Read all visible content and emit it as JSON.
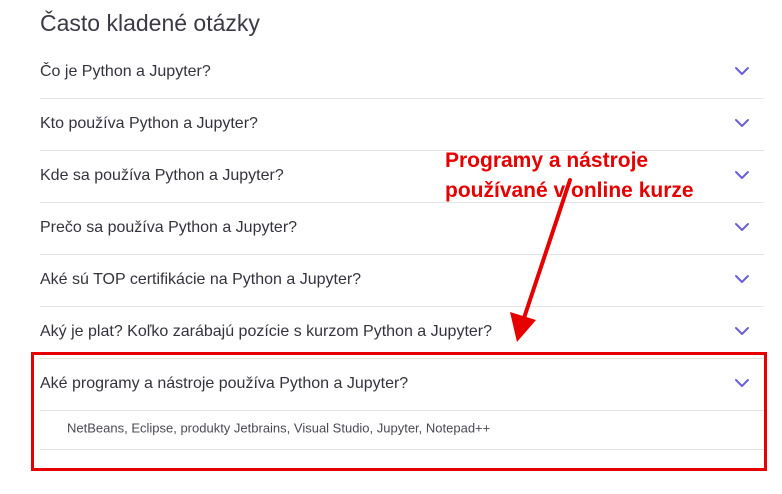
{
  "faq": {
    "title": "Často kladené otázky",
    "items": [
      {
        "question": "Čo je Python a Jupyter?",
        "expanded": false
      },
      {
        "question": "Kto používa Python a Jupyter?",
        "expanded": false
      },
      {
        "question": "Kde sa používa Python a Jupyter?",
        "expanded": false
      },
      {
        "question": "Prečo sa používa Python a Jupyter?",
        "expanded": false
      },
      {
        "question": "Aké sú TOP certifikácie na Python a Jupyter?",
        "expanded": false
      },
      {
        "question": "Aký je plat? Koľko zarábajú pozície s kurzom Python a Jupyter?",
        "expanded": false
      },
      {
        "question": "Aké programy a nástroje používa Python a Jupyter?",
        "expanded": true,
        "answer": "NetBeans, Eclipse, produkty Jetbrains, Visual Studio, Jupyter, Notepad++"
      }
    ]
  },
  "annotation": {
    "line1": "Programy a nástroje",
    "line2": "používané v online kurze",
    "color": "#e60000"
  },
  "colors": {
    "chevron": "#6b5fd6",
    "divider": "#e3e3e8",
    "highlight": "#e60000"
  },
  "icons": {
    "chevron": "chevron-down-icon"
  }
}
